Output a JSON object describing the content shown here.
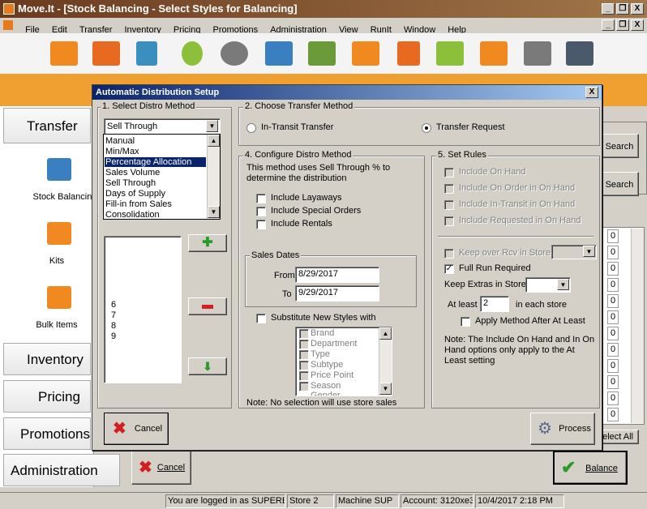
{
  "window": {
    "title": "Move.It - [Stock Balancing - Select Styles for Balancing]",
    "minimize": "_",
    "restore": "❐",
    "close": "X"
  },
  "menu": [
    "File",
    "Edit",
    "Transfer",
    "Inventory",
    "Pricing",
    "Promotions",
    "Administration",
    "View",
    "RunIt",
    "Window",
    "Help"
  ],
  "toolbar_icons": [
    "store-icon",
    "truck-icon",
    "pen-icon",
    "bulb-icon",
    "coins-icon",
    "mail-icon",
    "barcode-icon",
    "monitor-icon",
    "phone-icon",
    "book-icon",
    "chart-icon",
    "download-icon",
    "tools-icon"
  ],
  "nav": {
    "transfer": "Transfer",
    "stock_balancing": "Stock Balancing",
    "kits": "Kits",
    "bulk_items": "Bulk Items",
    "inventory": "Inventory",
    "pricing": "Pricing",
    "promotions": "Promotions",
    "administration": "Administration"
  },
  "background": {
    "search1": "Search",
    "search2": "Search",
    "grid_header": "0",
    "grid_values": [
      "0",
      "0",
      "0",
      "0",
      "0",
      "0",
      "0",
      "0",
      "0",
      "0",
      "0",
      "0"
    ],
    "select_all": "Select All",
    "cancel": "Cancel",
    "balance": "Balance"
  },
  "dialog": {
    "title": "Automatic Distribution Setup",
    "close": "X",
    "section1": {
      "label": "1. Select Distro Method",
      "selected": "Sell Through",
      "options": [
        "Manual",
        "Min/Max",
        "Percentage Allocation",
        "Sales Volume",
        "Sell Through",
        "Days of Supply",
        "Fill-in from Sales",
        "Consolidation"
      ],
      "highlighted": "Percentage Allocation",
      "store_list": [
        "6",
        "7",
        "8",
        "9"
      ]
    },
    "section2": {
      "label": "2. Choose Transfer Method",
      "in_transit": "In-Transit Transfer",
      "transfer_request": "Transfer Request",
      "selected": "Transfer Request"
    },
    "section4": {
      "label": "4. Configure Distro Method",
      "description": "This method uses Sell Through % to determine the distribution",
      "include_layaways": "Include Layaways",
      "include_special_orders": "Include Special Orders",
      "include_rentals": "Include Rentals",
      "sales_dates_label": "Sales Dates",
      "from_label": "From",
      "from_value": "8/29/2017",
      "to_label": "To",
      "to_value": "9/29/2017",
      "substitute_label": "Substitute New Styles with",
      "substitute_options": [
        "Brand",
        "Department",
        "Type",
        "Subtype",
        "Price Point",
        "Season",
        "Gender"
      ],
      "note": "Note: No selection will use store sales"
    },
    "section5": {
      "label": "5. Set Rules",
      "include_on_hand": "Include On Hand",
      "include_on_order": "Include On Order in On Hand",
      "include_in_transit": "Include In-Transit in On Hand",
      "include_requested": "Include Requested in On Hand",
      "keep_over_rcv": "Keep over Rcv in Store",
      "full_run_required": "Full Run Required",
      "full_run_checked": true,
      "keep_extras": "Keep Extras in Store",
      "at_least_label": "At least",
      "at_least_value": "2",
      "in_each_store": "in each store",
      "apply_method": "Apply Method After At Least",
      "note": "Note: The Include On Hand and In On Hand options only apply to the At Least setting"
    },
    "cancel": "Cancel",
    "process": "Process"
  },
  "status": {
    "logged_in": "You are logged in as SUPERER",
    "store": "Store 2",
    "machine": "Machine SUP",
    "account": "Account: 3120xe3",
    "datetime": "10/4/2017 2:18 PM"
  },
  "colors": {
    "title_gradient_start": "#6a3a1e",
    "orange_band": "#f0a030",
    "dialog_title": "#0a246a",
    "highlight": "#0a246a"
  }
}
